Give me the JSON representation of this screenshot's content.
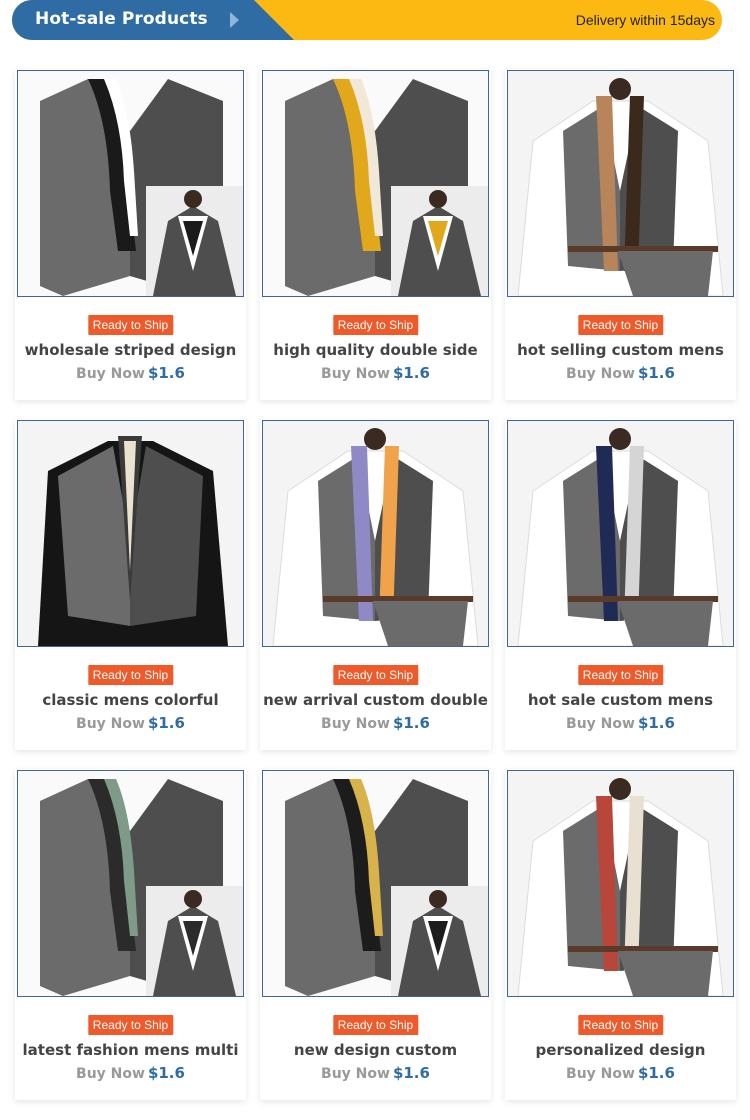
{
  "header": {
    "title": "Hot-sale Products",
    "arrow_icon": "chevron-right-icon",
    "delivery": "Delivery within 15days"
  },
  "colors": {
    "header_blue": "#2e6ca3",
    "header_yellow": "#fbb911",
    "badge": "#ef5a2b",
    "price": "#2e6ca3"
  },
  "products": [
    {
      "badge": "Ready to Ship",
      "name": "wholesale striped design",
      "buy_label": "Buy Now",
      "price": "$1.6",
      "scarf": [
        "#1a1a1a",
        "#ffffff"
      ],
      "image": "vest-with-inset"
    },
    {
      "badge": "Ready to Ship",
      "name": "high quality double side",
      "buy_label": "Buy Now",
      "price": "$1.6",
      "scarf": [
        "#e2a81c",
        "#f1e8d8"
      ],
      "image": "vest-with-inset"
    },
    {
      "badge": "Ready to Ship",
      "name": "hot selling custom mens",
      "buy_label": "Buy Now",
      "price": "$1.6",
      "scarf": [
        "#b8845a",
        "#3b2a1c"
      ],
      "image": "shirt-vest"
    },
    {
      "badge": "Ready to Ship",
      "name": "classic mens colorful",
      "buy_label": "Buy Now",
      "price": "$1.6",
      "scarf": [
        "#3a3a3a",
        "#e9e2cf"
      ],
      "image": "black-shirt-vest"
    },
    {
      "badge": "Ready to Ship",
      "name": "new arrival custom double",
      "buy_label": "Buy Now",
      "price": "$1.6",
      "scarf": [
        "#8f8ac6",
        "#f1a34c"
      ],
      "image": "shirt-vest-hanger"
    },
    {
      "badge": "Ready to Ship",
      "name": "hot sale custom mens",
      "buy_label": "Buy Now",
      "price": "$1.6",
      "scarf": [
        "#1f2a55",
        "#d5d5d5"
      ],
      "image": "shirt-vest-hanger"
    },
    {
      "badge": "Ready to Ship",
      "name": "latest fashion mens multi",
      "buy_label": "Buy Now",
      "price": "$1.6",
      "scarf": [
        "#2b2b2b",
        "#7f9a88"
      ],
      "image": "vest-with-inset"
    },
    {
      "badge": "Ready to Ship",
      "name": "new design custom",
      "buy_label": "Buy Now",
      "price": "$1.6",
      "scarf": [
        "#1c1c1c",
        "#d8b24a"
      ],
      "image": "vest-with-inset"
    },
    {
      "badge": "Ready to Ship",
      "name": "personalized design",
      "buy_label": "Buy Now",
      "price": "$1.6",
      "scarf": [
        "#b8463a",
        "#e8e0d0"
      ],
      "image": "shirt-vest-hanger"
    }
  ]
}
